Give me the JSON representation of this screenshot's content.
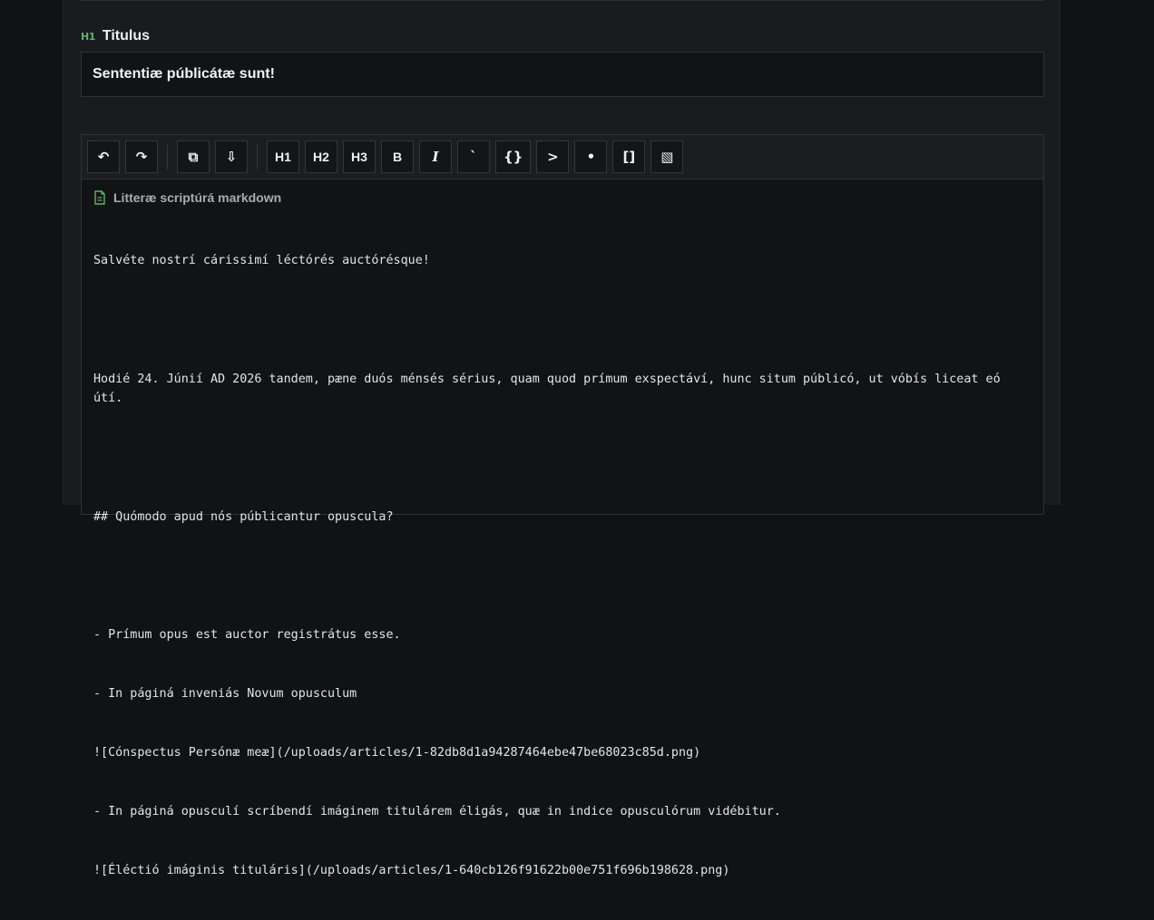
{
  "title_section": {
    "icon": "H1",
    "label": "Titulus",
    "value": "Sententiæ públicátæ sunt!"
  },
  "toolbar": {
    "buttons": [
      {
        "name": "undo-button",
        "label": "↶"
      },
      {
        "name": "redo-button",
        "label": "↷"
      },
      {
        "name": "copy-button",
        "label": "⧉"
      },
      {
        "name": "download-button",
        "label": "⇩"
      },
      {
        "name": "heading1-button",
        "label": "H1"
      },
      {
        "name": "heading2-button",
        "label": "H2"
      },
      {
        "name": "heading3-button",
        "label": "H3"
      },
      {
        "name": "bold-button",
        "label": "B"
      },
      {
        "name": "italic-button",
        "label": "I"
      },
      {
        "name": "inline-code-button",
        "label": "`"
      },
      {
        "name": "code-block-button",
        "label": "{}"
      },
      {
        "name": "quote-button",
        "label": ">"
      },
      {
        "name": "bullet-list-button",
        "label": "•"
      },
      {
        "name": "link-button",
        "label": "[]"
      },
      {
        "name": "image-button",
        "label": "▧"
      }
    ]
  },
  "editor": {
    "heading_icon": "document-icon",
    "heading": "Litteræ scriptúrá markdown",
    "lines": [
      "Salvéte nostrí cárissimí léctórés auctórésque!",
      "",
      "Hodié 24. Júnií AD 2026 tandem, pæne duós ménsés sérius, quam quod prímum exspectáví, hunc situm públicó, ut vóbís liceat eó útí.",
      "",
      "## Quómodo apud nós públicantur opuscula?",
      "",
      "- Prímum opus est auctor registrátus esse.",
      "- In páginá inveniás Novum opusculum",
      "![Cónspectus Persónæ meæ](/uploads/articles/1-82db8d1a94287464ebe47be68023c85d.png)",
      "- In páginá opusculí scríbendí imáginem titulárem éligás, quæ in indice opusculórum vidébitur.",
      "![Éléctió imáginis tituláris](/uploads/articles/1-640cb126f91622b00e751f696b198628.png)"
    ]
  },
  "colors": {
    "background": "#111214",
    "panel": "#1a1b1e",
    "accent_green": "#5fb36b",
    "spellcheck": "#e05050"
  }
}
